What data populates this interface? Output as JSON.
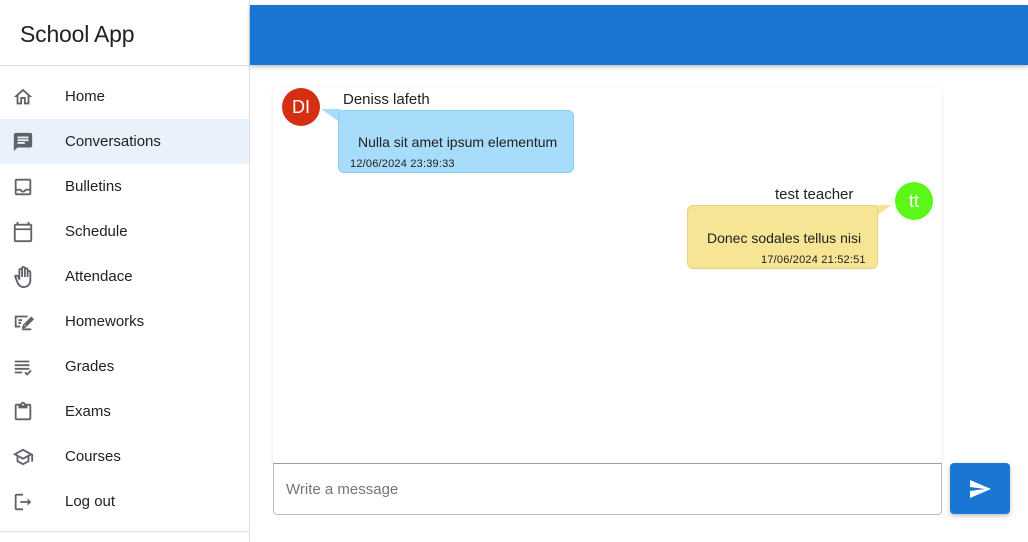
{
  "app": {
    "title": "School App"
  },
  "sidebar": {
    "items": [
      {
        "label": "Home",
        "icon": "home-icon",
        "active": false
      },
      {
        "label": "Conversations",
        "icon": "chat-icon",
        "active": true
      },
      {
        "label": "Bulletins",
        "icon": "inbox-icon",
        "active": false
      },
      {
        "label": "Schedule",
        "icon": "calendar-icon",
        "active": false
      },
      {
        "label": "Attendace",
        "icon": "hand-icon",
        "active": false
      },
      {
        "label": "Homeworks",
        "icon": "homework-icon",
        "active": false
      },
      {
        "label": "Grades",
        "icon": "grades-list-icon",
        "active": false
      },
      {
        "label": "Exams",
        "icon": "clipboard-icon",
        "active": false
      },
      {
        "label": "Courses",
        "icon": "school-icon",
        "active": false
      },
      {
        "label": "Log out",
        "icon": "logout-icon",
        "active": false
      }
    ]
  },
  "topbar": {
    "color": "#1976d2"
  },
  "chat": {
    "messages": [
      {
        "sender": "Deniss lafeth",
        "initials": "DI",
        "avatar_color": "#d32f10",
        "text": "Nulla sit amet ipsum elementum",
        "timestamp": "12/06/2024 23:39:33",
        "bubble_color": "#a8dcfb",
        "side": "left"
      },
      {
        "sender": "test teacher",
        "initials": "tt",
        "avatar_color": "#5cf719",
        "text": "Donec sodales tellus nisi",
        "timestamp": "17/06/2024 21:52:51",
        "bubble_color": "#f7e596",
        "side": "right"
      }
    ]
  },
  "composer": {
    "placeholder": "Write a message",
    "value": "",
    "send_icon": "send-icon"
  }
}
